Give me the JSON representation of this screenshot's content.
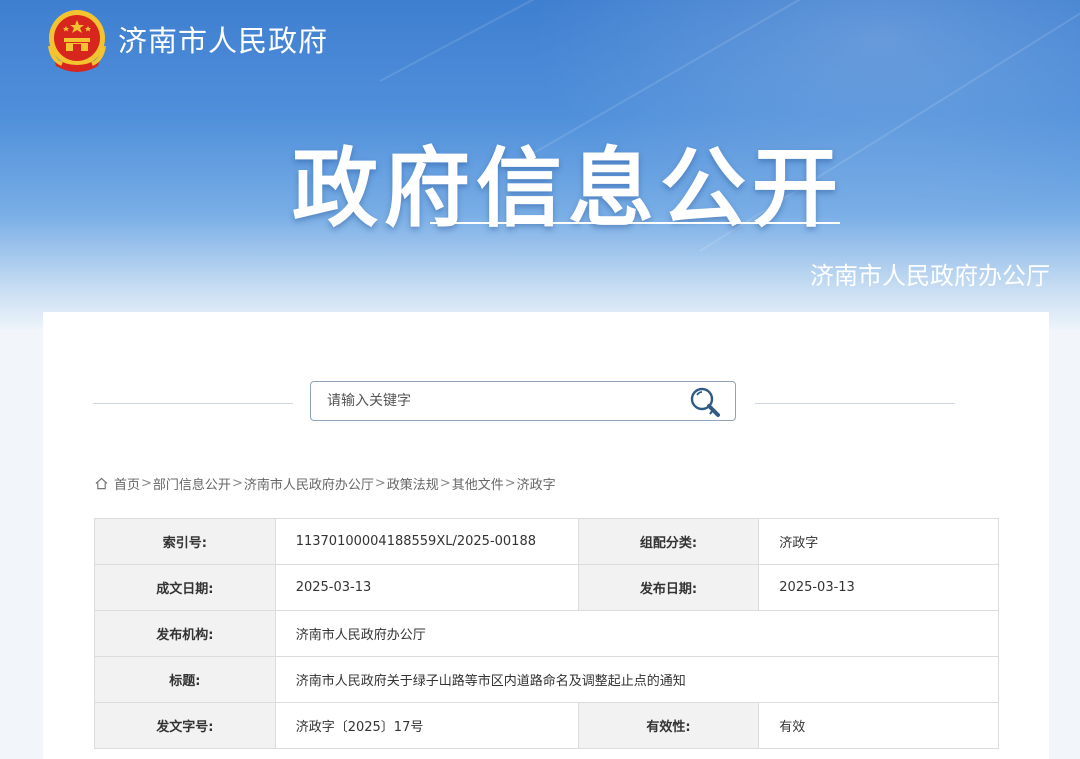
{
  "header": {
    "site_name": "济南市人民政府",
    "main_title": "政府信息公开",
    "office_name": "济南市人民政府办公厅"
  },
  "search": {
    "placeholder": "请输入关键字",
    "value": ""
  },
  "breadcrumb": [
    {
      "label": "首页"
    },
    {
      "label": "部门信息公开"
    },
    {
      "label": "济南市人民政府办公厅"
    },
    {
      "label": "政策法规"
    },
    {
      "label": "其他文件"
    },
    {
      "label": "济政字"
    }
  ],
  "breadcrumb_separator": ">",
  "info": {
    "index_label": "索引号:",
    "index_value": "11370100004188559XL/2025-00188",
    "category_label": "组配分类:",
    "category_value": "济政字",
    "written_date_label": "成文日期:",
    "written_date_value": "2025-03-13",
    "publish_date_label": "发布日期:",
    "publish_date_value": "2025-03-13",
    "publisher_label": "发布机构:",
    "publisher_value": "济南市人民政府办公厅",
    "title_label": "标题:",
    "title_value": "济南市人民政府关于绿子山路等市区内道路命名及调整起止点的通知",
    "doc_no_label": "发文字号:",
    "doc_no_value": "济政字〔2025〕17号",
    "validity_label": "有效性:",
    "validity_value": "有效"
  },
  "icons": {
    "logo": "national-emblem-icon",
    "search": "search-icon",
    "home": "home-icon"
  },
  "colors": {
    "banner_top": "#3f7fd0",
    "emblem_red": "#d7261e",
    "emblem_gold": "#f4c430",
    "search_border": "#8da4bb",
    "table_key_bg": "#f2f2f2"
  }
}
